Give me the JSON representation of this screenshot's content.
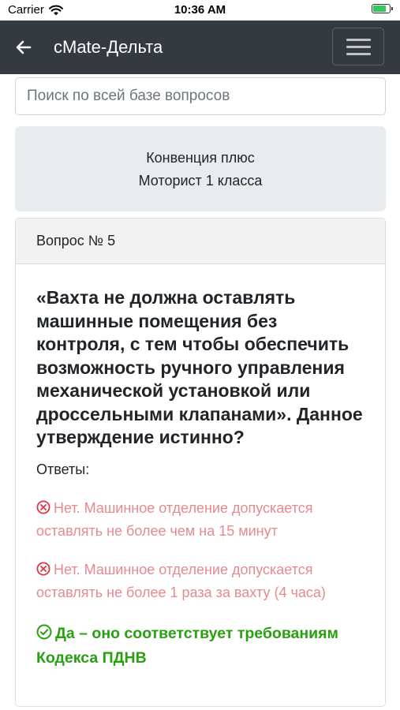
{
  "status_bar": {
    "carrier": "Carrier",
    "time": "10:36 AM",
    "battery_level": 0.85,
    "battery_color": "#34c759"
  },
  "navbar": {
    "title": "cMate-Дельта",
    "back_icon": "arrow-left-icon",
    "menu_icon": "hamburger-menu-icon",
    "background": "#343a40"
  },
  "search": {
    "placeholder": "Поиск по всей базе вопросов",
    "value": ""
  },
  "info": {
    "line1": "Конвенция плюс",
    "line2": "Моторист 1 класса"
  },
  "question_card": {
    "header": "Вопрос № 5",
    "question": "«Вахта не должна оставлять машинные помещения без контроля, с тем чтобы обеспечить возможность ручного управления механической установкой или дроссельными клапанами». Данное утверждение истинно?",
    "answers_label": "Ответы:",
    "answers": [
      {
        "text": "Нет. Машинное отделение допускается оставлять не более чем на 15 минут",
        "correct": false,
        "icon": "x-circle-icon"
      },
      {
        "text": "Нет. Машинное отделение допускается оставлять не более 1 раза за вахту (4 часа)",
        "correct": false,
        "icon": "x-circle-icon"
      },
      {
        "text": "Да – оно соответствует требованиям Кодекса ПДНВ",
        "correct": true,
        "icon": "check-circle-icon"
      }
    ],
    "colors": {
      "wrong": "#e58a8f",
      "right": "#28a012",
      "wrong_icon": "#dc3545"
    }
  }
}
